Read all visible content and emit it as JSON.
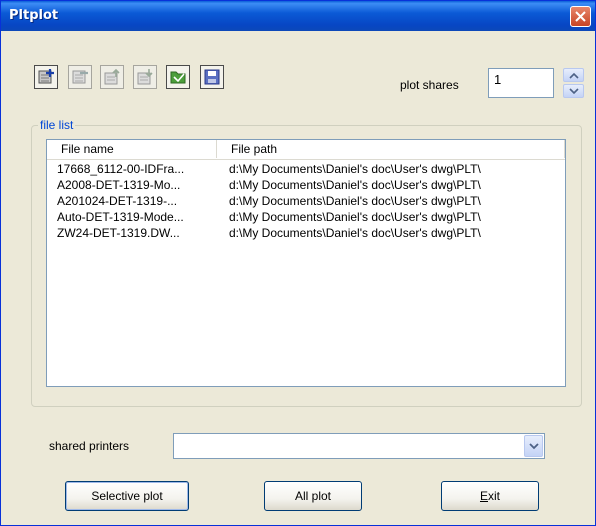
{
  "window": {
    "title": "Pltplot"
  },
  "toolbar": {
    "buttons": [
      {
        "icon": "add-file-icon",
        "enabled": true
      },
      {
        "icon": "remove-file-icon",
        "enabled": false
      },
      {
        "icon": "move-up-icon",
        "enabled": false
      },
      {
        "icon": "move-down-icon",
        "enabled": false
      },
      {
        "icon": "open-folder-icon",
        "enabled": true
      },
      {
        "icon": "save-icon",
        "enabled": true
      }
    ]
  },
  "plot_shares": {
    "label": "plot shares",
    "value": "1"
  },
  "file_list": {
    "title": "file list",
    "columns": [
      "File name",
      "File path"
    ],
    "rows": [
      [
        "17668_6112-00-IDFra...",
        "d:\\My Documents\\Daniel's doc\\User's dwg\\PLT\\"
      ],
      [
        "A2008-DET-1319-Mo...",
        "d:\\My Documents\\Daniel's doc\\User's dwg\\PLT\\"
      ],
      [
        "A201024-DET-1319-...",
        "d:\\My Documents\\Daniel's doc\\User's dwg\\PLT\\"
      ],
      [
        "Auto-DET-1319-Mode...",
        "d:\\My Documents\\Daniel's doc\\User's dwg\\PLT\\"
      ],
      [
        "ZW24-DET-1319.DW...",
        "d:\\My Documents\\Daniel's doc\\User's dwg\\PLT\\"
      ]
    ]
  },
  "shared_printers": {
    "label": "shared printers",
    "value": ""
  },
  "buttons": {
    "selective_plot": "Selective plot",
    "all_plot": "All plot",
    "exit_prefix": "E",
    "exit_rest": "xit"
  }
}
